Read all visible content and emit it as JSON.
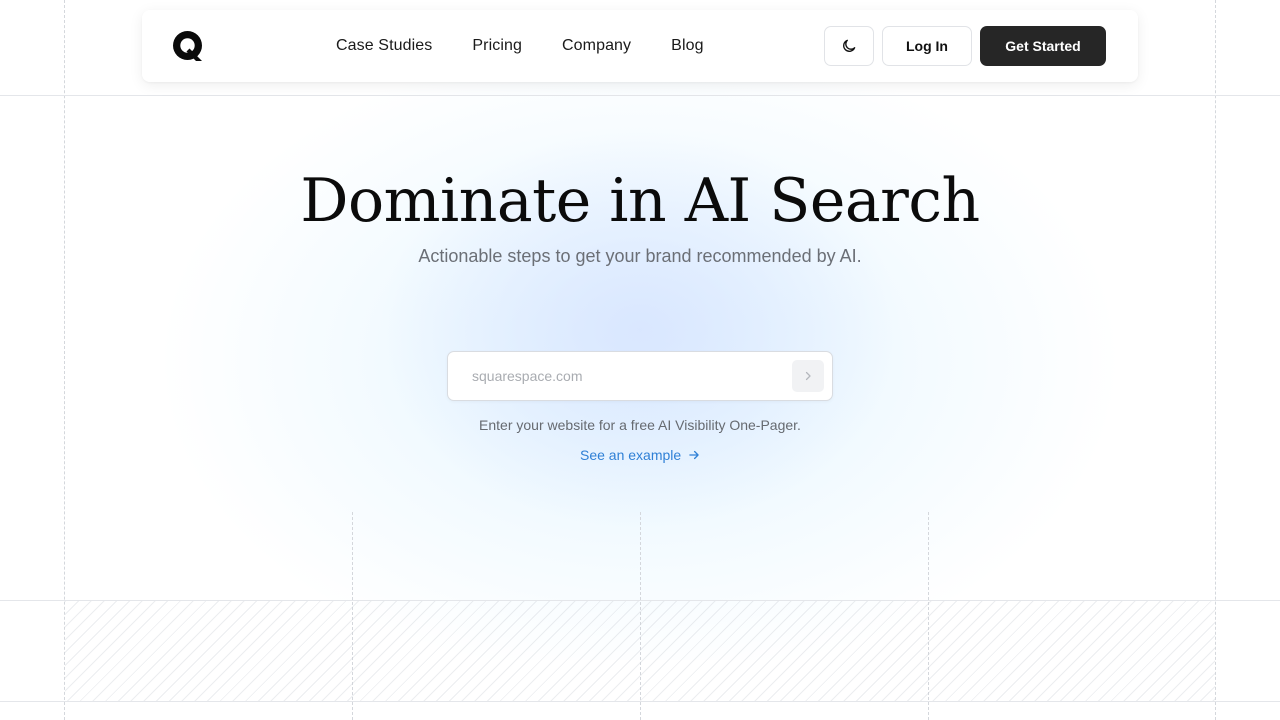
{
  "brand": {
    "logo_icon": "q-logo-icon"
  },
  "nav": {
    "links": [
      "Case Studies",
      "Pricing",
      "Company",
      "Blog"
    ],
    "theme_toggle_icon": "moon-icon",
    "login_label": "Log In",
    "cta_label": "Get Started"
  },
  "hero": {
    "title": "Dominate in AI Search",
    "subtitle": "Actionable steps to get your brand recommended by AI."
  },
  "search": {
    "placeholder": "squarespace.com",
    "value": "",
    "submit_icon": "chevron-right-icon"
  },
  "helper_text": "Enter your website for a free AI Visibility One-Pager.",
  "example_link": {
    "label": "See an example",
    "icon": "arrow-right-icon"
  },
  "colors": {
    "primary_button": "#262626",
    "link": "#2f80d6",
    "muted_text": "#6b6f76"
  }
}
